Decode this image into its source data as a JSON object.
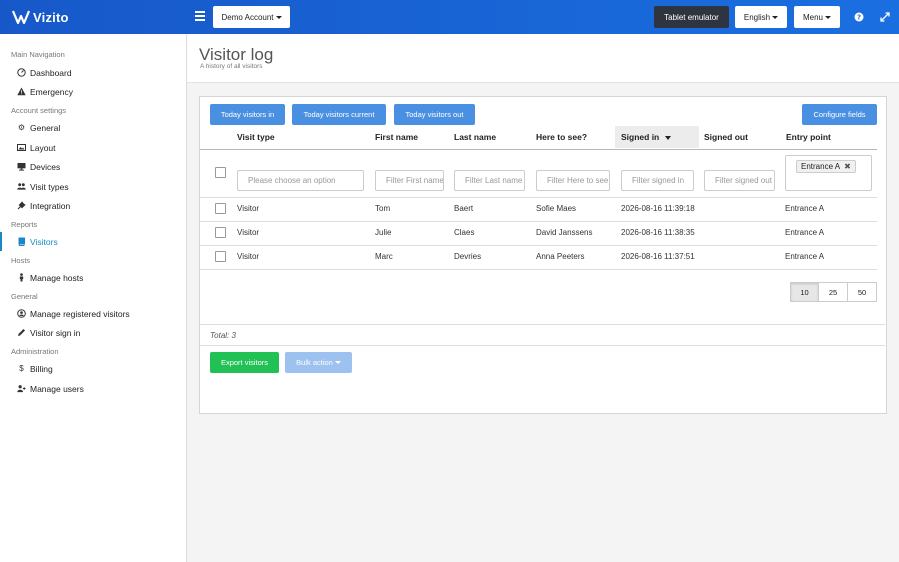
{
  "app": {
    "brand": "Vizito"
  },
  "topbar": {
    "account_label": "Demo Account",
    "tablet_label": "Tablet emulator",
    "language_label": "English",
    "menu_label": "Menu"
  },
  "sidebar": {
    "sections": {
      "main_navigation": "Main Navigation",
      "account_settings": "Account settings",
      "reports": "Reports",
      "hosts": "Hosts",
      "general": "General",
      "administration": "Administration"
    },
    "items": {
      "dashboard": "Dashboard",
      "emergency": "Emergency",
      "general": "General",
      "layout": "Layout",
      "devices": "Devices",
      "visit_types": "Visit types",
      "integration": "Integration",
      "visitors": "Visitors",
      "manage_hosts": "Manage hosts",
      "manage_registered_visitors": "Manage registered visitors",
      "visitor_sign_in": "Visitor sign in",
      "billing": "Billing",
      "manage_users": "Manage users"
    }
  },
  "page": {
    "title": "Visitor log",
    "subtitle": "A history of all visitors"
  },
  "toolbar": {
    "today_in": "Today visitors in",
    "today_current": "Today visitors current",
    "today_out": "Today visitors out",
    "configure": "Configure fields"
  },
  "table": {
    "headers": {
      "visit_type": "Visit type",
      "first_name": "First name",
      "last_name": "Last name",
      "here_to_see": "Here to see?",
      "signed_in": "Signed in",
      "signed_out": "Signed out",
      "entry_point": "Entry point"
    },
    "filters": {
      "visit_type": "Please choose an option",
      "first_name": "Filter First name",
      "last_name": "Filter Last name",
      "here_to_see": "Filter Here to see?",
      "signed_in": "Filter signed in",
      "signed_out": "Filter signed out",
      "entry_point_tag": "Entrance A",
      "tag_remove": "✖"
    },
    "rows": [
      {
        "visit_type": "Visitor",
        "first_name": "Tom",
        "last_name": "Baert",
        "here_to_see": "Sofie Maes",
        "signed_in": "2026-08-16 11:39:18",
        "signed_out": "",
        "entry_point": "Entrance A"
      },
      {
        "visit_type": "Visitor",
        "first_name": "Julie",
        "last_name": "Claes",
        "here_to_see": "David Janssens",
        "signed_in": "2026-08-16 11:38:35",
        "signed_out": "",
        "entry_point": "Entrance A"
      },
      {
        "visit_type": "Visitor",
        "first_name": "Marc",
        "last_name": "Devries",
        "here_to_see": "Anna Peeters",
        "signed_in": "2026-08-16 11:37:51",
        "signed_out": "",
        "entry_point": "Entrance A"
      }
    ],
    "page_sizes": [
      "10",
      "25",
      "50"
    ],
    "selected_page_size": "10",
    "total": "Total: 3"
  },
  "footer": {
    "export": "Export visitors",
    "bulk": "Bulk action"
  },
  "colors": {
    "brand": "#1a6fe0",
    "primary_button": "#4a90e2",
    "success": "#21c156",
    "active_nav": "#1a88c7"
  }
}
